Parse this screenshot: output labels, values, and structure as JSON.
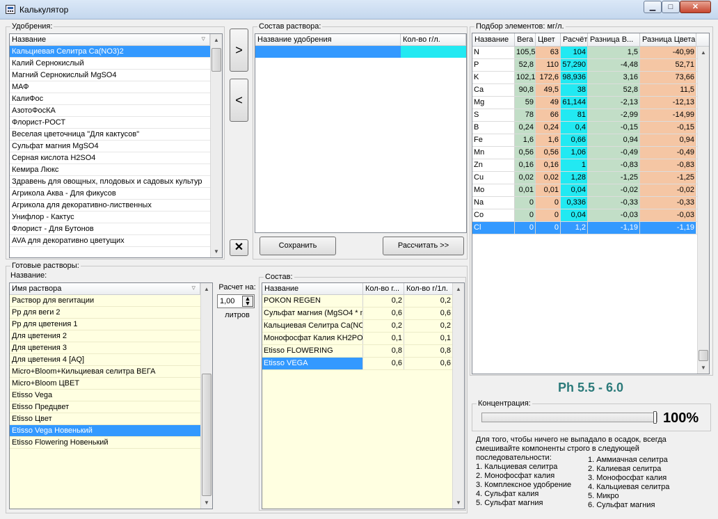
{
  "window": {
    "title": "Калькулятор",
    "controls": {
      "minimize": "▁",
      "maximize": "□",
      "close": "✕"
    }
  },
  "fertilizers": {
    "group_label": "Удобрения:",
    "header": "Название",
    "items": [
      "Кальциевая Селитра Ca(NO3)2",
      "Калий Сернокислый",
      "Магний Сернокислый MgSO4",
      "МАФ",
      "КалиФос",
      "АзотоФосКА",
      "Флорист-РОСТ",
      "Веселая цветочница \"Для кактусов\"",
      "Сульфат магния MgSO4",
      "Серная кислота H2SO4",
      "Кемира Люкс",
      "Здравень для овощных, плодовых и садовых культур",
      "Агрикола Аква - Для фикусов",
      "Агрикола для декоративно-лиственных",
      "Унифлор - Кактус",
      "Флорист - Для Бутонов",
      "AVA для декоративно цветущих"
    ],
    "selected_index": 0
  },
  "transfer": {
    "add_label": ">",
    "remove_label": "<",
    "delete_label": "✕"
  },
  "solution": {
    "group_label": "Состав раствора:",
    "headers": [
      "Название удобрения",
      "Кол-во г/л."
    ],
    "save_label": "Сохранить",
    "calc_label": "Рассчитать >>"
  },
  "elements": {
    "group_label": "Подбор элементов: мг/л.",
    "headers": [
      "Название",
      "Вега",
      "Цвет",
      "Расчёт",
      "Разница В...",
      "Разница Цвета"
    ],
    "rows": [
      [
        "N",
        "105,5",
        "63",
        "104",
        "1,5",
        "-40,99"
      ],
      [
        "P",
        "52,8",
        "110",
        "57,290",
        "-4,48",
        "52,71"
      ],
      [
        "K",
        "102,1",
        "172,6",
        "98,936",
        "3,16",
        "73,66"
      ],
      [
        "Ca",
        "90,8",
        "49,5",
        "38",
        "52,8",
        "11,5"
      ],
      [
        "Mg",
        "59",
        "49",
        "61,144",
        "-2,13",
        "-12,13"
      ],
      [
        "S",
        "78",
        "66",
        "81",
        "-2,99",
        "-14,99"
      ],
      [
        "B",
        "0,24",
        "0,24",
        "0,4",
        "-0,15",
        "-0,15"
      ],
      [
        "Fe",
        "1,6",
        "1,6",
        "0,66",
        "0,94",
        "0,94"
      ],
      [
        "Mn",
        "0,56",
        "0,56",
        "1,06",
        "-0,49",
        "-0,49"
      ],
      [
        "Zn",
        "0,16",
        "0,16",
        "1",
        "-0,83",
        "-0,83"
      ],
      [
        "Cu",
        "0,02",
        "0,02",
        "1,28",
        "-1,25",
        "-1,25"
      ],
      [
        "Mo",
        "0,01",
        "0,01",
        "0,04",
        "-0,02",
        "-0,02"
      ],
      [
        "Na",
        "0",
        "0",
        "0,336",
        "-0,33",
        "-0,33"
      ],
      [
        "Co",
        "0",
        "0",
        "0,04",
        "-0,03",
        "-0,03"
      ],
      [
        "Cl",
        "0",
        "0",
        "1,2",
        "-1,19",
        "-1,19"
      ]
    ],
    "selected_index": 14
  },
  "ready": {
    "group_label": "Готовые растворы:",
    "name_label": "Название:",
    "header": "Имя раствора",
    "items": [
      "Раствор для вегитации",
      "Рр для веги 2",
      "Рр для цветения 1",
      "Для цветения 2",
      "Для цветения 3",
      "Для цветения 4 [AQ]",
      "Micro+Bloom+Кильциевая селитра ВЕГА",
      "Micro+Bloom ЦВЕТ",
      "Etisso Vega",
      "Etisso Предцвет",
      "Etisso Цвет",
      "Etisso Vega Новенький",
      "Etisso Flowering Новенький"
    ],
    "selected_index": 11
  },
  "calc": {
    "label": "Расчет на:",
    "value": "1,00",
    "unit": "литров"
  },
  "composition": {
    "group_label": "Состав:",
    "headers": [
      "Название",
      "Кол-во г...",
      "Кол-во г/1л."
    ],
    "rows": [
      [
        "POKON REGEN",
        "0,2",
        "0,2"
      ],
      [
        "Сульфат магния (MgSO4 * n",
        "0,6",
        "0,6"
      ],
      [
        "Кальциевая Селитра Ca(NO",
        "0,2",
        "0,2"
      ],
      [
        "Монофосфат Калия KH2PO4",
        "0,1",
        "0,1"
      ],
      [
        "Etisso FLOWERING",
        "0,8",
        "0,8"
      ],
      [
        "Etisso VEGA",
        "0,6",
        "0,6"
      ]
    ],
    "selected_index": 5
  },
  "ph": {
    "text": "Ph 5.5 - 6.0"
  },
  "concentration": {
    "group_label": "Концентрация:",
    "percent_text": "100%",
    "level": 1.0
  },
  "notes": {
    "intro": "Для того, чтобы ничего не выпадало в осадок, всегда смешивайте компоненты строго в следующей последовательности:",
    "left": [
      "1. Кальциевая селитра",
      "2. Монофосфат калия",
      "3. Комплексное удобрение",
      "4. Сульфат калия",
      "5. Сульфат магния"
    ],
    "right": [
      "1. Аммиачная селитра",
      "2. Калиевая селитра",
      "3. Монофосфат калия",
      "4. Кальциевая селитра",
      "5. Микро",
      "6. Сульфат магния"
    ]
  },
  "colors": {
    "selection": "#3399ff",
    "cyan": "#22e9f2",
    "green": "#c2dec7",
    "orange": "#f5c6a4",
    "ph": "#2b7a7a",
    "yellow": "#ffffe1"
  }
}
